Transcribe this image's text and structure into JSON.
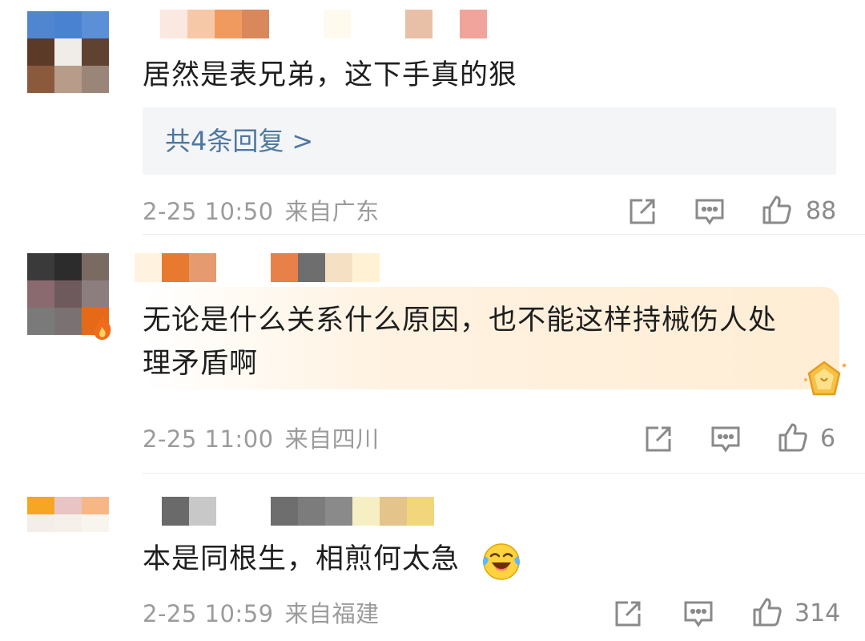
{
  "comments": [
    {
      "text": "居然是表兄弟，这下手真的狠",
      "reply_link": "共4条回复",
      "time": "2-25 10:50",
      "source": "来自广东",
      "likes": "88",
      "avatar_colors": [
        "#4f86cf",
        "#4a82d2",
        "#5b8fd8",
        "#5b3a28",
        "#f0ece8",
        "#5f4330",
        "#8b5a3c",
        "#b89c8a",
        "#9a8678"
      ],
      "name_colors": [
        "#ffffff",
        "#fbe8e0",
        "#f6c8a8",
        "#f09a60",
        "#d9885c",
        "#ffffff",
        "#ffffff",
        "#fffaee",
        "#ffffff",
        "#ffffff",
        "#e8c0a8",
        "#ffffff",
        "#f0a49c"
      ]
    },
    {
      "text_line1": "无论是什么关系什么原因，也不能这样持械伤人处",
      "text_line2": "理矛盾啊",
      "time": "2-25 11:00",
      "source": "来自四川",
      "likes": "6",
      "avatar_colors": [
        "#3a3a3a",
        "#2c2c2c",
        "#7a6a62",
        "#8a6a6e",
        "#6e5a5c",
        "#8c7e7e",
        "#7a7a7a",
        "#7a7272",
        "#e56a18"
      ],
      "name_colors": [
        "#fff3df",
        "#e87a30",
        "#e69a70",
        "#ffffff",
        "#ffffff",
        "#e8804a",
        "#6e6e6e",
        "#f6e0c4",
        "#fff2d4"
      ]
    },
    {
      "text": "本是同根生，相煎何太急",
      "time": "2-25 10:59",
      "source": "来自福建",
      "likes": "314",
      "avatar_colors": [
        "#f5a623",
        "#e8c4c4",
        "#f7b784",
        "#f3eeea",
        "#f6f0ea",
        "#f8f4ee",
        "#ffffff",
        "#ffffff",
        "#ffffff"
      ],
      "name_colors": [
        "#ffffff",
        "#6a6a6a",
        "#c8c8c8",
        "#ffffff",
        "#ffffff",
        "#6e6e6e",
        "#7c7c7c",
        "#8a8a8a",
        "#f7efc4",
        "#e4c48a",
        "#f2d67c"
      ]
    }
  ],
  "icons": {
    "share": "share-icon",
    "comment": "comment-icon",
    "like": "thumbs-up-icon"
  }
}
